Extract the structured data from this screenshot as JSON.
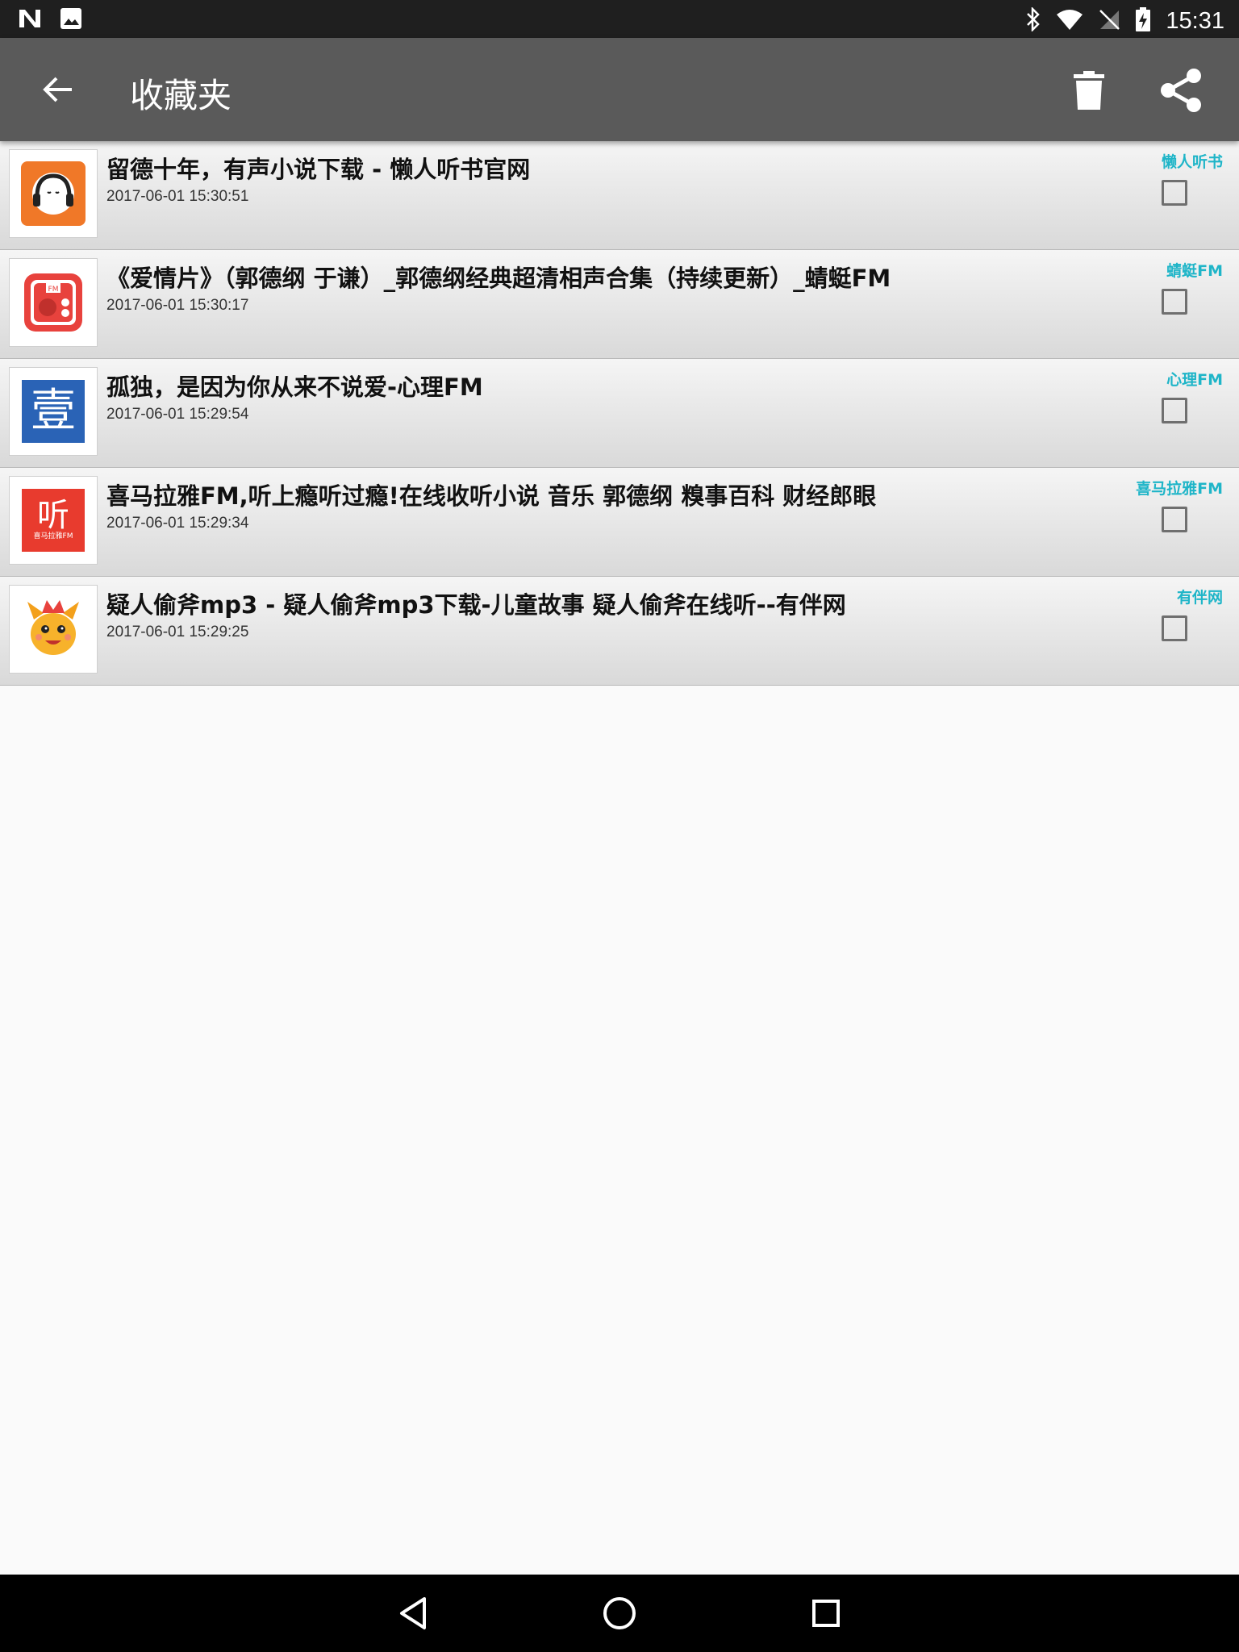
{
  "status_bar": {
    "time": "15:31",
    "left_icons": [
      "n-notification-icon",
      "image-notification-icon"
    ],
    "right_icons": [
      "bluetooth-icon",
      "wifi-icon",
      "no-sim-icon",
      "battery-charging-icon"
    ]
  },
  "app_bar": {
    "title": "收藏夹",
    "background": "#5a5a5a",
    "actions": [
      "back-arrow-icon",
      "trash-icon",
      "share-icon"
    ]
  },
  "accent_color": "#1fb5c8",
  "favorites": [
    {
      "title": "留德十年，有声小说下载 - 懒人听书官网",
      "time": "2017-06-01 15:30:51",
      "source": "懒人听书",
      "icon": "lanren-headphones-icon",
      "checked": false
    },
    {
      "title": "《爱情片》（郭德纲 于谦）_郭德纲经典超清相声合集（持续更新）_蜻蜓FM",
      "time": "2017-06-01 15:30:17",
      "source": "蜻蜓FM",
      "icon": "qingting-radio-icon",
      "checked": false
    },
    {
      "title": "孤独，是因为你从来不说爱-心理FM",
      "time": "2017-06-01 15:29:54",
      "source": "心理FM",
      "icon": "xinli-yi-icon",
      "icon_glyph": "壹",
      "checked": false
    },
    {
      "title": "喜马拉雅FM,听上瘾听过瘾!在线收听小说 音乐 郭德纲 糗事百科 财经郎眼",
      "time": "2017-06-01 15:29:34",
      "source": "喜马拉雅FM",
      "icon": "ximalaya-ting-icon",
      "icon_glyph": "听",
      "icon_caption": "喜马拉雅FM",
      "checked": false
    },
    {
      "title": "疑人偷斧mp3 - 疑人偷斧mp3下载-儿童故事 疑人偷斧在线听--有伴网",
      "time": "2017-06-01 15:29:25",
      "source": "有伴网",
      "icon": "youban-dragon-icon",
      "checked": false
    }
  ],
  "nav_bar": [
    "back-triangle-icon",
    "home-circle-icon",
    "recents-square-icon"
  ]
}
